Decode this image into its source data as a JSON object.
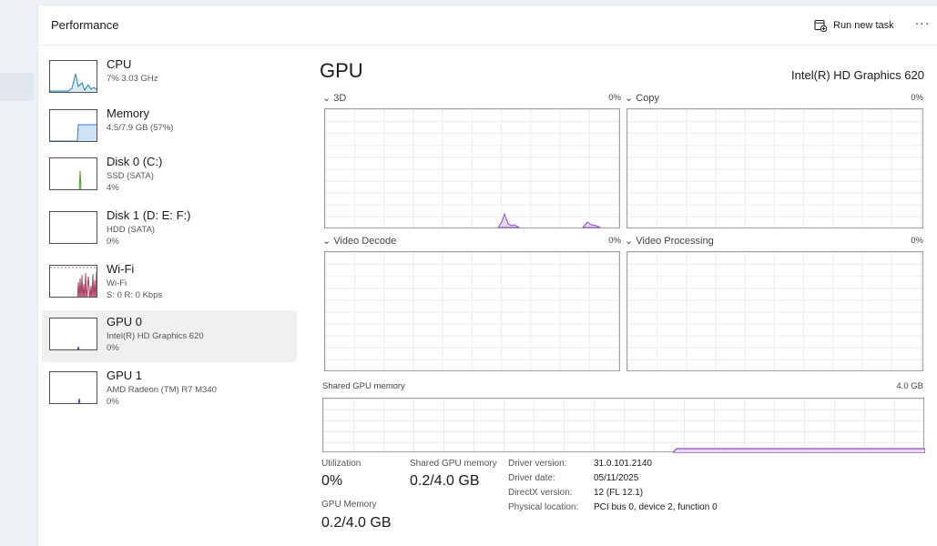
{
  "header": {
    "title": "Performance",
    "run_task_label": "Run new task",
    "more_label": "···"
  },
  "sidebar": {
    "items": [
      {
        "name": "CPU",
        "line2": "7% 3.03 GHz",
        "line3": "",
        "graph_color": "#1a83b6",
        "active": false
      },
      {
        "name": "Memory",
        "line2": "4.5/7.9 GB (57%)",
        "line3": "",
        "graph_color": "#3a7dc9",
        "active": false
      },
      {
        "name": "Disk 0 (C:)",
        "line2": "SSD (SATA)",
        "line3": "4%",
        "graph_color": "#4c9a2a",
        "active": false
      },
      {
        "name": "Disk 1 (D: E: F:)",
        "line2": "HDD (SATA)",
        "line3": "0%",
        "graph_color": "#4c9a2a",
        "active": false
      },
      {
        "name": "Wi-Fi",
        "line2": "Wi-Fi",
        "line3": "S: 0 R: 0 Kbps",
        "graph_color": "#a0284c",
        "active": false
      },
      {
        "name": "GPU 0",
        "line2": "Intel(R) HD Graphics 620",
        "line3": "0%",
        "graph_color": "#3a3adf",
        "active": true
      },
      {
        "name": "GPU 1",
        "line2": "AMD Radeon (TM) R7 M340",
        "line3": "0%",
        "graph_color": "#3a3adf",
        "active": false
      }
    ]
  },
  "main": {
    "title": "GPU",
    "model": "Intel(R) HD Graphics 620",
    "engines": [
      {
        "label": "3D",
        "percent": "0%"
      },
      {
        "label": "Copy",
        "percent": "0%"
      },
      {
        "label": "Video Decode",
        "percent": "0%"
      },
      {
        "label": "Video Processing",
        "percent": "0%"
      }
    ],
    "shared_memory": {
      "label": "Shared GPU memory",
      "max": "4.0 GB"
    },
    "stats": {
      "utilization_label": "Utilization",
      "utilization_value": "0%",
      "shared_label": "Shared GPU memory",
      "shared_value": "0.2/4.0 GB",
      "gpu_memory_label": "GPU Memory",
      "gpu_memory_value": "0.2/4.0 GB"
    },
    "details": [
      {
        "key": "Driver version:",
        "value": "31.0.101.2140"
      },
      {
        "key": "Driver date:",
        "value": "05/11/2025"
      },
      {
        "key": "DirectX version:",
        "value": "12 (FL 12.1)"
      },
      {
        "key": "Physical location:",
        "value": "PCI bus 0, device 2, function 0"
      }
    ],
    "graph_color": "#8c4fc5"
  }
}
